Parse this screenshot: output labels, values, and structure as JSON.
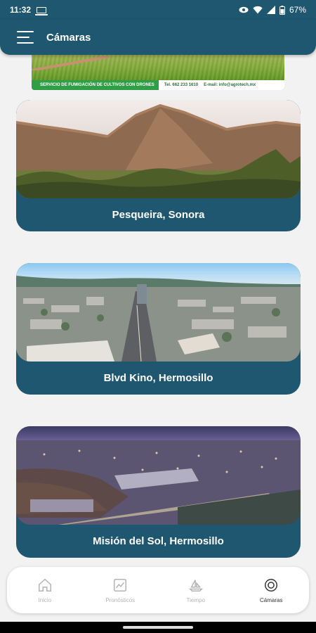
{
  "status_bar": {
    "time": "11:32",
    "battery": "67%"
  },
  "app_bar": {
    "title": "Cámaras"
  },
  "banner": {
    "tagline": "SERVICIO DE FUMIGACIÓN DE CULTIVOS CON DRONES",
    "phone": "Tel. 662 233 1610",
    "email": "E-mail: info@agrotech.mx"
  },
  "cameras": [
    {
      "name": "Pesqueira, Sonora"
    },
    {
      "name": "Blvd Kino, Hermosillo"
    },
    {
      "name": "Misión del Sol, Hermosillo"
    }
  ],
  "bottom_nav": {
    "items": [
      {
        "label": "Inicio",
        "icon": "home-icon"
      },
      {
        "label": "Pronósticos",
        "icon": "chart-icon"
      },
      {
        "label": "Tiempo",
        "icon": "boat-icon"
      },
      {
        "label": "Cámaras",
        "icon": "camera-lens-icon"
      }
    ],
    "active": "Cámaras"
  },
  "colors": {
    "primary": "#1f5670",
    "background": "#f2f2f2"
  }
}
